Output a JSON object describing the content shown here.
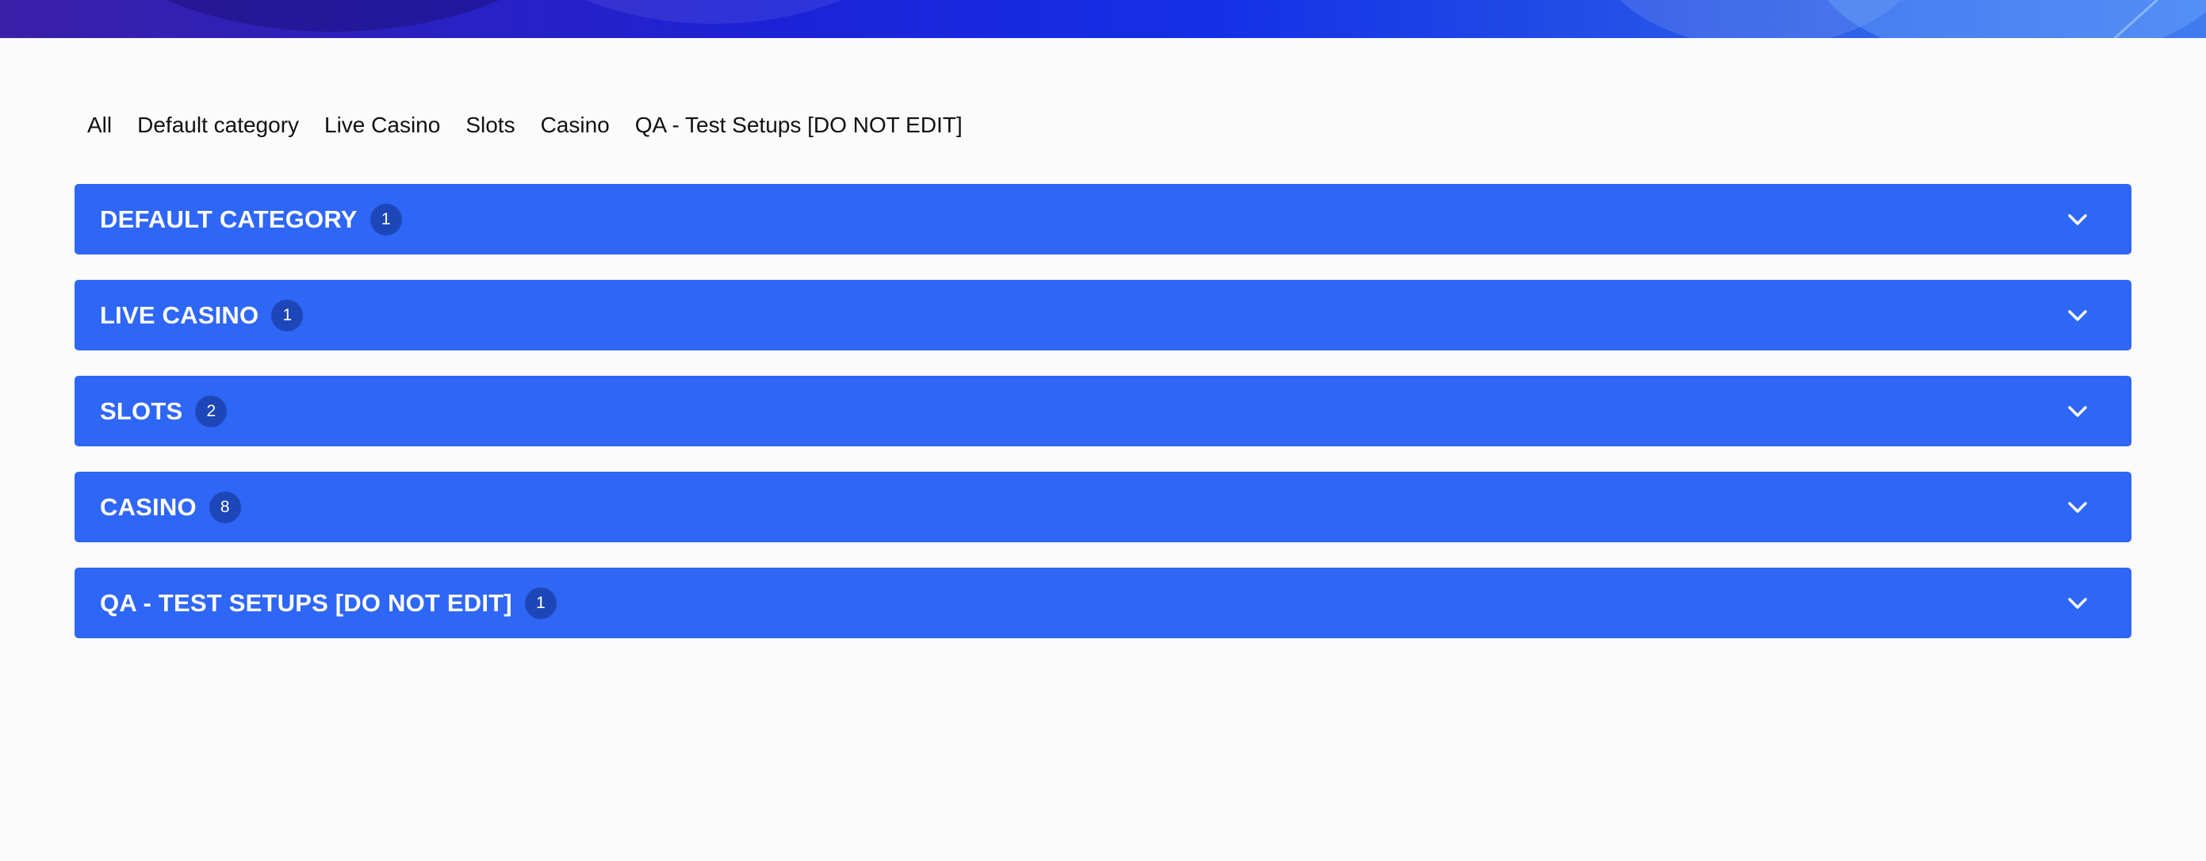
{
  "banner": {
    "colors": {
      "start": "#3a1fa8",
      "mid": "#1430e6",
      "end": "#3f7cf0"
    }
  },
  "tabs": [
    {
      "label": "All"
    },
    {
      "label": "Default category"
    },
    {
      "label": "Live Casino"
    },
    {
      "label": "Slots"
    },
    {
      "label": "Casino"
    },
    {
      "label": "QA - Test Setups [DO NOT EDIT]"
    }
  ],
  "sections": [
    {
      "title": "DEFAULT CATEGORY",
      "count": "1",
      "icon": "chevron-down-icon"
    },
    {
      "title": "LIVE CASINO",
      "count": "1",
      "icon": "chevron-down-icon"
    },
    {
      "title": "SLOTS",
      "count": "2",
      "icon": "chevron-down-icon"
    },
    {
      "title": "CASINO",
      "count": "8",
      "icon": "chevron-down-icon"
    },
    {
      "title": "QA - TEST SETUPS [DO NOT EDIT]",
      "count": "1",
      "icon": "chevron-down-icon"
    }
  ],
  "colors": {
    "accent": "#2e66f5",
    "badge": "#1d47b8",
    "page_bg": "#fbfbfb"
  }
}
